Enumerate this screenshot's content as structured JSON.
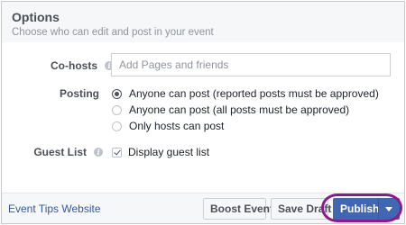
{
  "header": {
    "title": "Options",
    "subtitle": "Choose who can edit and post in your event"
  },
  "cohosts": {
    "label": "Co-hosts",
    "placeholder": "Add Pages and friends",
    "info_icon": "info-icon"
  },
  "posting": {
    "label": "Posting",
    "options": [
      {
        "label": "Anyone can post (reported posts must be approved)",
        "selected": true
      },
      {
        "label": "Anyone can post (all posts must be approved)",
        "selected": false
      },
      {
        "label": "Only hosts can post",
        "selected": false
      }
    ]
  },
  "guest_list": {
    "label": "Guest List",
    "info_icon": "info-icon",
    "checkbox_label": "Display guest list",
    "checked": true
  },
  "footer": {
    "tips_link": "Event Tips Website",
    "boost_label": "Boost Event",
    "draft_label": "Save Draft",
    "publish_label": "Publish",
    "dropdown_icon": "chevron-down-icon"
  },
  "colors": {
    "primary": "#4267b2",
    "link": "#365899",
    "highlight": "#8c1a8f"
  }
}
